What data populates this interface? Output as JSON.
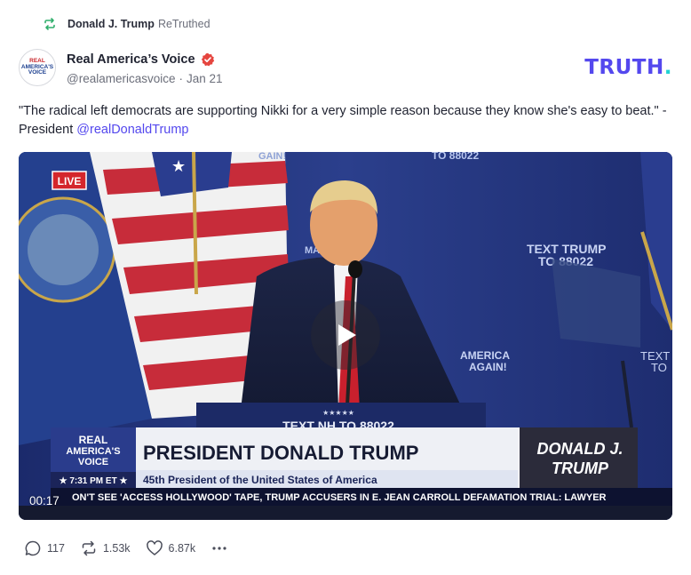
{
  "retruth": {
    "icon": "retruth-icon",
    "name": "Donald J. Trump",
    "suffix": "ReTruthed"
  },
  "author": {
    "avatar": {
      "line1": "REAL",
      "line2": "AMERICA'S",
      "line3": "VOICE"
    },
    "name": "Real America’s Voice",
    "verified_icon": "verified-badge-icon",
    "handle": "@realamericasvoice",
    "separator": "·",
    "date": "Jan 21"
  },
  "brand": {
    "text": "TRUTH",
    "dot": ".",
    "color": "#5448ee",
    "dot_color": "#22d3d3"
  },
  "post": {
    "text": "\"The radical left democrats are supporting Nikki for a very simple reason because they know she's easy to beat.\" - President ",
    "mention": "@realDonaldTrump",
    "mention_color": "#5448ee"
  },
  "video": {
    "timecode": "00:17",
    "play_icon": "play-icon",
    "scene": {
      "live_badge": "LIVE",
      "backdrop_text_top_left": "GAIN!",
      "backdrop_text_top_mid": "TO 88022",
      "backdrop_text_right_1": "TEXT TRUMP",
      "backdrop_text_right_2": "TO 88022",
      "backdrop_text_mid_left": "MA",
      "backdrop_text_mid_right": "AMERICA",
      "backdrop_text_mid_right_2": "AGAIN!",
      "backdrop_text_far_right": "TEXT",
      "backdrop_text_far_right_2": "TO",
      "podium_stars": "★★★★★",
      "podium_text": "TEXT NH TO 88022"
    },
    "lower_third": {
      "network_line1": "REAL",
      "network_line2": "AMERICA'S",
      "network_line3": "VOICE",
      "time": "★ 7:31 PM ET ★",
      "headline": "PRESIDENT DONALD TRUMP",
      "subhead": "45th President of the United States of America",
      "ticker": "ON'T SEE 'ACCESS HOLLYWOOD' TAPE, TRUMP ACCUSERS IN E. JEAN CARROLL DEFAMATION TRIAL: LAWYER",
      "logo_line1": "DONALD J.",
      "logo_line2": "TRUMP"
    }
  },
  "actions": {
    "replies": {
      "icon": "reply-icon",
      "count": "117"
    },
    "retruths": {
      "icon": "retruth-icon",
      "count": "1.53k"
    },
    "likes": {
      "icon": "heart-icon",
      "count": "6.87k"
    },
    "more": {
      "icon": "more-dots-icon"
    }
  }
}
